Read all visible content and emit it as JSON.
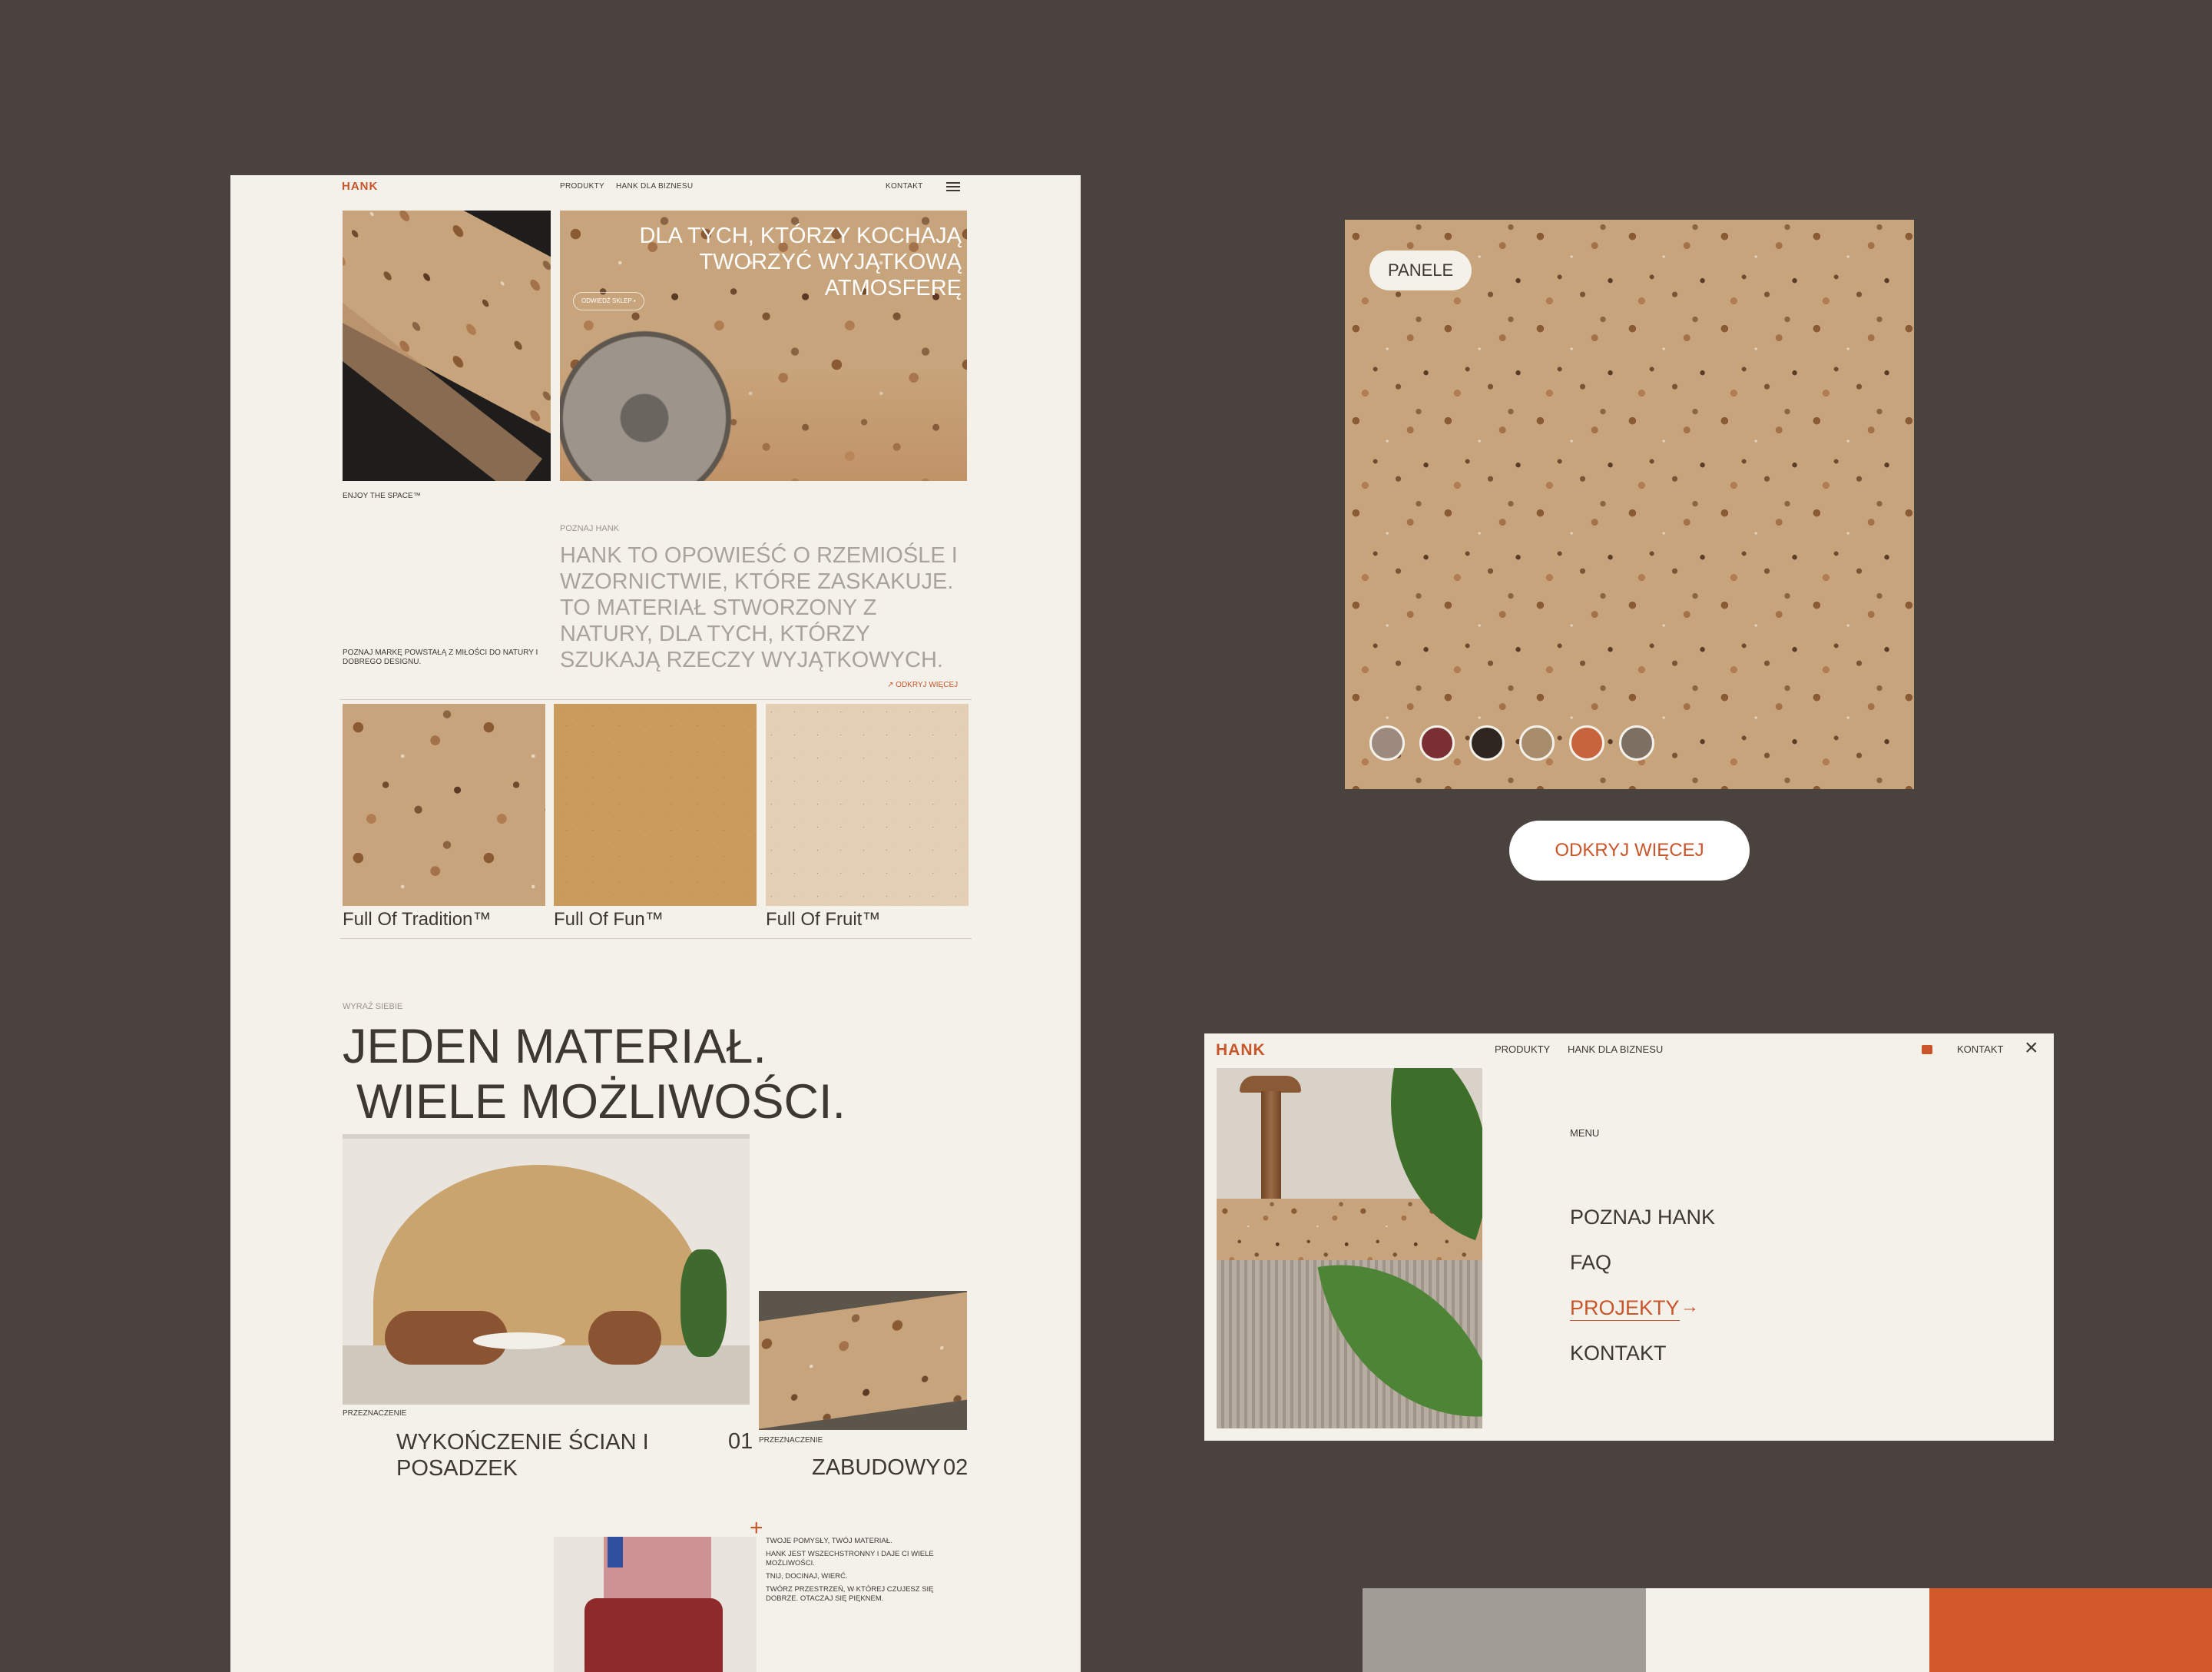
{
  "page": {
    "brand": "HANK",
    "nav": {
      "products": "PRODUKTY",
      "business": "HANK DLA BIZNESU",
      "contact": "KONTAKT"
    },
    "hero": {
      "headline_line1": "DLA TYCH, KTÓRZY KOCHAJĄ",
      "headline_line2": "TWORZYĆ WYJĄTKOWĄ ATMOSFERĘ",
      "cta": "ODWIEDŹ SKLEP",
      "tagline": "ENJOY THE SPACE™"
    },
    "about": {
      "label": "POZNAJ HANK",
      "intro": "POZNAJ MARKĘ POWSTAŁĄ Z MIŁOŚCI DO NATURY I DOBREGO DESIGNU.",
      "text": "HANK TO OPOWIEŚĆ O RZEMIOŚLE I WZORNICTWIE, KTÓRE ZASKAKUJE. TO MATERIAŁ STWORZONY Z NATURY, DLA TYCH, KTÓRZY SZUKAJĄ RZECZY WYJĄTKOWYCH.",
      "link": "ODKRYJ WIĘCEJ"
    },
    "products": [
      {
        "name": "Full Of Tradition™"
      },
      {
        "name": "Full Of Fun™"
      },
      {
        "name": "Full Of Fruit™"
      }
    ],
    "express": {
      "label": "WYRAŹ SIEBIE",
      "headline_line1": "JEDEN MATERIAŁ.",
      "headline_line2": "WIELE MOŻLIWOŚCI."
    },
    "uses": [
      {
        "label": "PRZEZNACZENIE",
        "title": "WYKOŃCZENIE ŚCIAN I POSADZEK",
        "number": "01"
      },
      {
        "label": "PRZEZNACZENIE",
        "title": "ZABUDOWY",
        "number": "02"
      }
    ],
    "ideas": {
      "line1": "TWOJE POMYSŁY, TWÓJ MATERIAŁ.",
      "line2": "HANK JEST WSZECHSTRONNY I DAJE CI WIELE MOŻLIWOŚCI.",
      "line3": "TNIJ, DOCINAJ, WIERĆ.",
      "line4": "TWÓRZ PRZESTRZEŃ, W KTÓREJ CZUJESZ SIĘ DOBRZE. OTACZAJ SIĘ PIĘKNEM."
    }
  },
  "panel": {
    "badge": "PANELE",
    "swatches": [
      "#9b8a7d",
      "#7a2f33",
      "#2f2620",
      "#a88d6d",
      "#c8643d",
      "#7d7063"
    ],
    "button": "ODKRYJ WIĘCEJ"
  },
  "menu": {
    "brand": "HANK",
    "nav_products": "PRODUKTY",
    "nav_business": "HANK DLA BIZNESU",
    "nav_contact": "KONTAKT",
    "label": "MENU",
    "items": [
      "POZNAJ HANK",
      "FAQ",
      "PROJEKTY",
      "KONTAKT"
    ],
    "active_index": 2
  },
  "palette": [
    "#a29c96",
    "#f4f1eb",
    "#d1592a"
  ],
  "colors": {
    "accent": "#c8562a",
    "background": "#4a423e",
    "cream": "#f4f1eb"
  }
}
